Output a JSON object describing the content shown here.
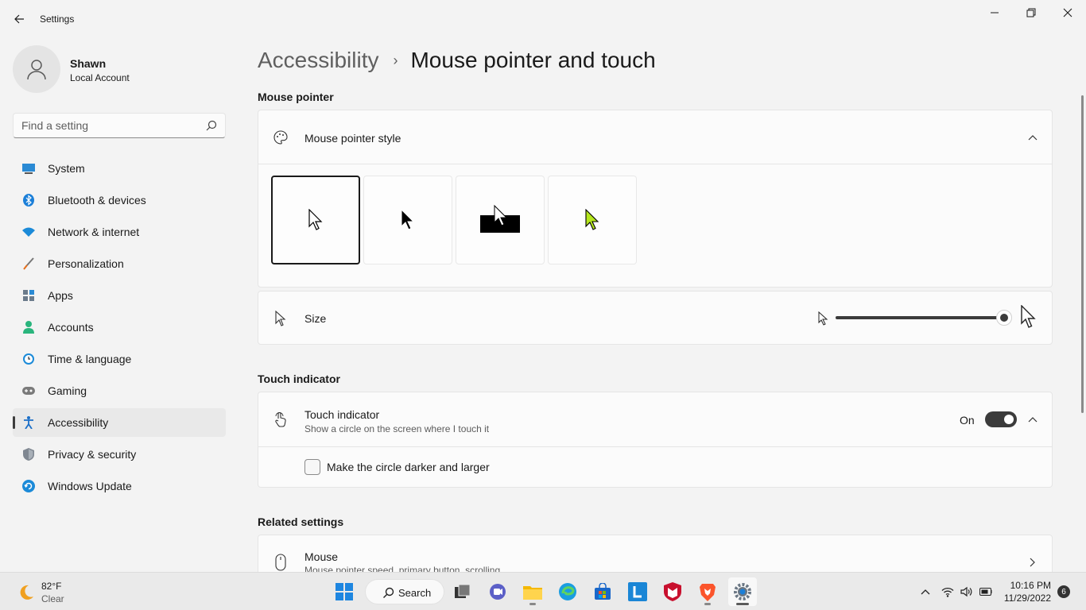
{
  "window": {
    "title": "Settings"
  },
  "profile": {
    "name": "Shawn",
    "account_type": "Local Account"
  },
  "search": {
    "placeholder": "Find a setting"
  },
  "sidebar": {
    "items": [
      {
        "label": "System",
        "icon": "system-icon"
      },
      {
        "label": "Bluetooth & devices",
        "icon": "bluetooth-icon"
      },
      {
        "label": "Network & internet",
        "icon": "wifi-icon"
      },
      {
        "label": "Personalization",
        "icon": "brush-icon"
      },
      {
        "label": "Apps",
        "icon": "apps-icon"
      },
      {
        "label": "Accounts",
        "icon": "person-icon"
      },
      {
        "label": "Time & language",
        "icon": "clock-globe-icon"
      },
      {
        "label": "Gaming",
        "icon": "gamepad-icon"
      },
      {
        "label": "Accessibility",
        "icon": "accessibility-icon",
        "active": true
      },
      {
        "label": "Privacy & security",
        "icon": "shield-icon"
      },
      {
        "label": "Windows Update",
        "icon": "update-icon"
      }
    ]
  },
  "breadcrumb": {
    "parent": "Accessibility",
    "separator": "›",
    "current": "Mouse pointer and touch"
  },
  "mouse_pointer": {
    "section_title": "Mouse pointer",
    "style_label": "Mouse pointer style",
    "style_options": [
      {
        "name": "white",
        "selected": true
      },
      {
        "name": "black",
        "selected": false
      },
      {
        "name": "inverted",
        "selected": false
      },
      {
        "name": "custom",
        "selected": false,
        "color": "#b5e61d"
      }
    ],
    "size_label": "Size",
    "size_value_fraction": 1.0
  },
  "touch": {
    "section_title": "Touch indicator",
    "label": "Touch indicator",
    "description": "Show a circle on the screen where I touch it",
    "toggle_state": "On",
    "toggle_on": true,
    "darker_label": "Make the circle darker and larger",
    "darker_checked": false
  },
  "related": {
    "section_title": "Related settings",
    "mouse_label": "Mouse",
    "mouse_description": "Mouse pointer speed, primary button, scrolling"
  },
  "taskbar": {
    "weather_temp": "82°F",
    "weather_condition": "Clear",
    "search_label": "Search",
    "time": "10:16 PM",
    "date": "11/29/2022",
    "notification_count": "6"
  },
  "colors": {
    "accent_dark": "#3b3b3b",
    "window_bg": "#f3f3f3",
    "card_bg": "#fbfbfb",
    "custom_pointer": "#b5e61d"
  }
}
